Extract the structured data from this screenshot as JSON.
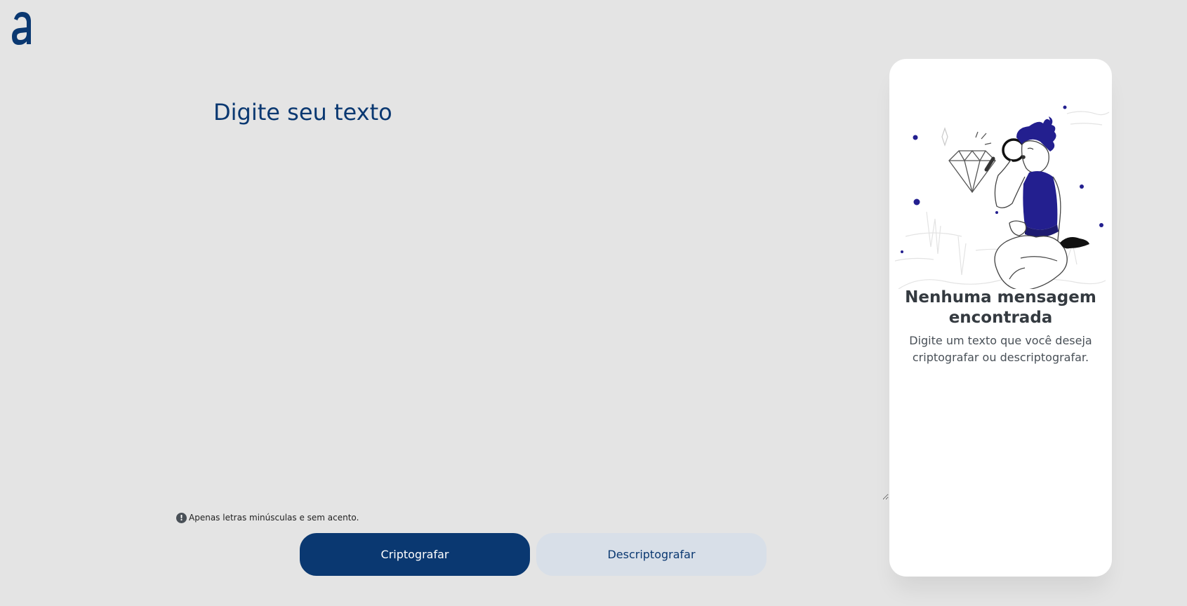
{
  "header": {
    "logo_icon": "alura-a-logo-icon"
  },
  "input": {
    "placeholder": "Digite seu texto",
    "value": ""
  },
  "hint": {
    "icon": "exclamation-circle-icon",
    "text": "Apenas letras minúsculas e sem acento."
  },
  "buttons": {
    "encrypt_label": "Criptografar",
    "decrypt_label": "Descriptografar"
  },
  "output": {
    "illustration": "person-with-magnifying-glass-illustration",
    "title": "Nenhuma mensagem encontrada",
    "description": "Digite um texto que você deseja criptografar ou descriptografar."
  },
  "colors": {
    "background": "#e4e4e4",
    "primary": "#0a3871",
    "secondary_button_bg": "#d8dfe8",
    "card_bg": "#ffffff",
    "title_text": "#343a40",
    "body_text": "#495057",
    "illustration_accent": "#231f8f"
  }
}
